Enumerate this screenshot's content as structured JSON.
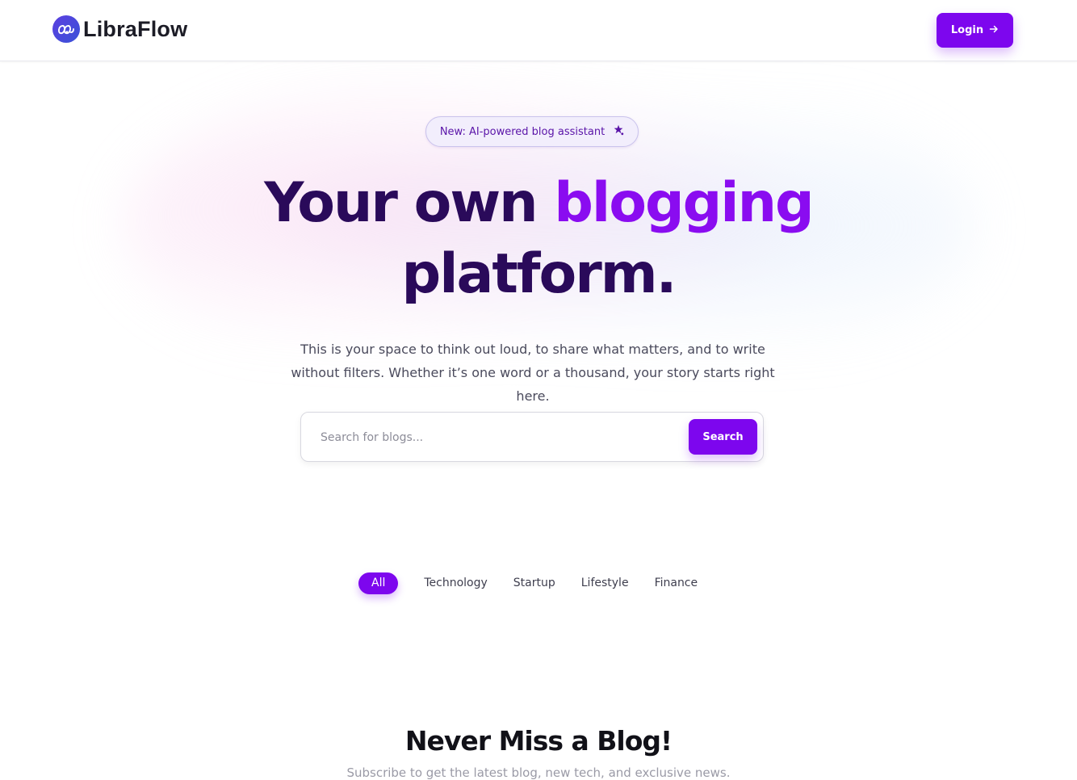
{
  "brand": {
    "name": "LibraFlow",
    "logo_icon": "infinity-loop-icon",
    "logo_color": "#4b47dc"
  },
  "header": {
    "login_label": "Login",
    "login_icon": "arrow-right-icon"
  },
  "hero": {
    "badge_text": "New: AI-powered blog assistant",
    "badge_icon": "star-icon",
    "title_part1": "Your own ",
    "title_accent": "blogging",
    "title_part2": "platform.",
    "description": "This is your space to think out loud, to share what matters, and to write without filters. Whether it’s one word or a thousand, your story starts right here."
  },
  "search": {
    "placeholder": "Search for blogs...",
    "value": "",
    "button_label": "Search"
  },
  "categories": {
    "items": [
      {
        "label": "All",
        "active": true
      },
      {
        "label": "Technology",
        "active": false
      },
      {
        "label": "Startup",
        "active": false
      },
      {
        "label": "Lifestyle",
        "active": false
      },
      {
        "label": "Finance",
        "active": false
      }
    ]
  },
  "newsletter": {
    "title": "Never Miss a Blog!",
    "subtitle": "Subscribe to get the latest blog, new tech, and exclusive news."
  },
  "colors": {
    "accent": "#7d06ee",
    "title_dark": "#2a0a5a",
    "title_accent": "#8a0cf0"
  }
}
